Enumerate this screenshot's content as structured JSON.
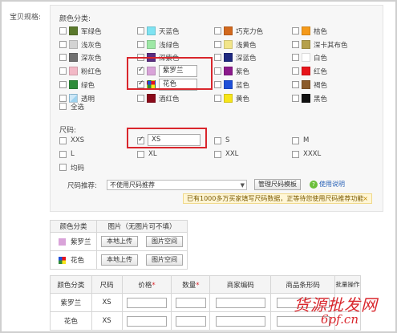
{
  "left_label": "宝贝规格:",
  "color_section": {
    "title": "颜色分类:",
    "colors": [
      {
        "label": "军绿色",
        "hex": "#5b7a2d",
        "checked": false
      },
      {
        "label": "天蓝色",
        "hex": "#7fe3f2",
        "checked": false
      },
      {
        "label": "巧克力色",
        "hex": "#d2691e",
        "checked": false
      },
      {
        "label": "桔色",
        "hex": "#f59a1a",
        "checked": false
      },
      {
        "label": "浅灰色",
        "hex": "#d3d3d3",
        "checked": false
      },
      {
        "label": "浅绿色",
        "hex": "#9ee8a6",
        "checked": false
      },
      {
        "label": "浅黄色",
        "hex": "#f2e58a",
        "checked": false
      },
      {
        "label": "深卡其布色",
        "hex": "#b5a04a",
        "checked": false
      },
      {
        "label": "深灰色",
        "hex": "#707070",
        "checked": false
      },
      {
        "label": "深紫色",
        "hex": "#5a2d82",
        "checked": false
      },
      {
        "label": "深蓝色",
        "hex": "#1f2a80",
        "checked": false
      },
      {
        "label": "白色",
        "hex": "#ffffff",
        "checked": false
      },
      {
        "label": "粉红色",
        "hex": "#f2b8c6",
        "checked": false
      },
      {
        "label": "紫罗兰",
        "hex": "#d9a3d9",
        "checked": true,
        "custom_value": "紫罗兰"
      },
      {
        "label": "紫色",
        "hex": "#8b1a8b",
        "checked": false
      },
      {
        "label": "红色",
        "hex": "#e8141a",
        "checked": false
      },
      {
        "label": "绿色",
        "hex": "#2e8b3a",
        "checked": false
      },
      {
        "label": "花色",
        "hex": "#e0b040",
        "checked": true,
        "custom_value": "花色"
      },
      {
        "label": "蓝色",
        "hex": "#1e4fd8",
        "checked": false
      },
      {
        "label": "褐色",
        "hex": "#8a5a2a",
        "checked": false
      },
      {
        "label": "透明",
        "hex": "#cfe8f7",
        "checked": false
      },
      {
        "label": "酒红色",
        "hex": "#8b0a1a",
        "checked": false
      },
      {
        "label": "黄色",
        "hex": "#f7e51a",
        "checked": false
      },
      {
        "label": "黑色",
        "hex": "#111111",
        "checked": false
      }
    ],
    "select_all": "全选"
  },
  "size_section": {
    "title": "尺码:",
    "sizes": [
      {
        "label": "XXS",
        "checked": false
      },
      {
        "label": "XS",
        "checked": true,
        "custom_value": "XS"
      },
      {
        "label": "S",
        "checked": false
      },
      {
        "label": "M",
        "checked": false
      },
      {
        "label": "L",
        "checked": false
      },
      {
        "label": "XL",
        "checked": false
      },
      {
        "label": "XXL",
        "checked": false
      },
      {
        "label": "XXXL",
        "checked": false
      }
    ],
    "uniform_label": "均码",
    "recommend_label": "尺码推荐:",
    "recommend_select": "不使用尺码推荐",
    "manage_button": "管理尺码模板",
    "help_link": "使用说明",
    "notice": "已有1000多万买家填写尺码数据，正等待您使用尺码推荐功能",
    "notice_close": "×"
  },
  "picture_table": {
    "headers": [
      "颜色分类",
      "图片（无图片可不填）"
    ],
    "rows": [
      {
        "color": "紫罗兰",
        "swatch": "#d9a3d9",
        "upload": "本地上传",
        "space": "图片空间"
      },
      {
        "color": "花色",
        "swatch": "#e0b040",
        "upload": "本地上传",
        "space": "图片空间"
      }
    ]
  },
  "sku_table": {
    "headers": [
      "颜色分类",
      "尺码",
      "价格",
      "数量",
      "商家编码",
      "商品条形码",
      "批量操作"
    ],
    "required_mark": "*",
    "rows": [
      {
        "color": "紫罗兰",
        "size": "XS"
      },
      {
        "color": "花色",
        "size": "XS"
      }
    ]
  },
  "watermark": {
    "line1": "货源批发网",
    "line2": "6pf.cn"
  },
  "colors": {
    "highlight": "#d9262c",
    "link": "#2a63b8"
  }
}
